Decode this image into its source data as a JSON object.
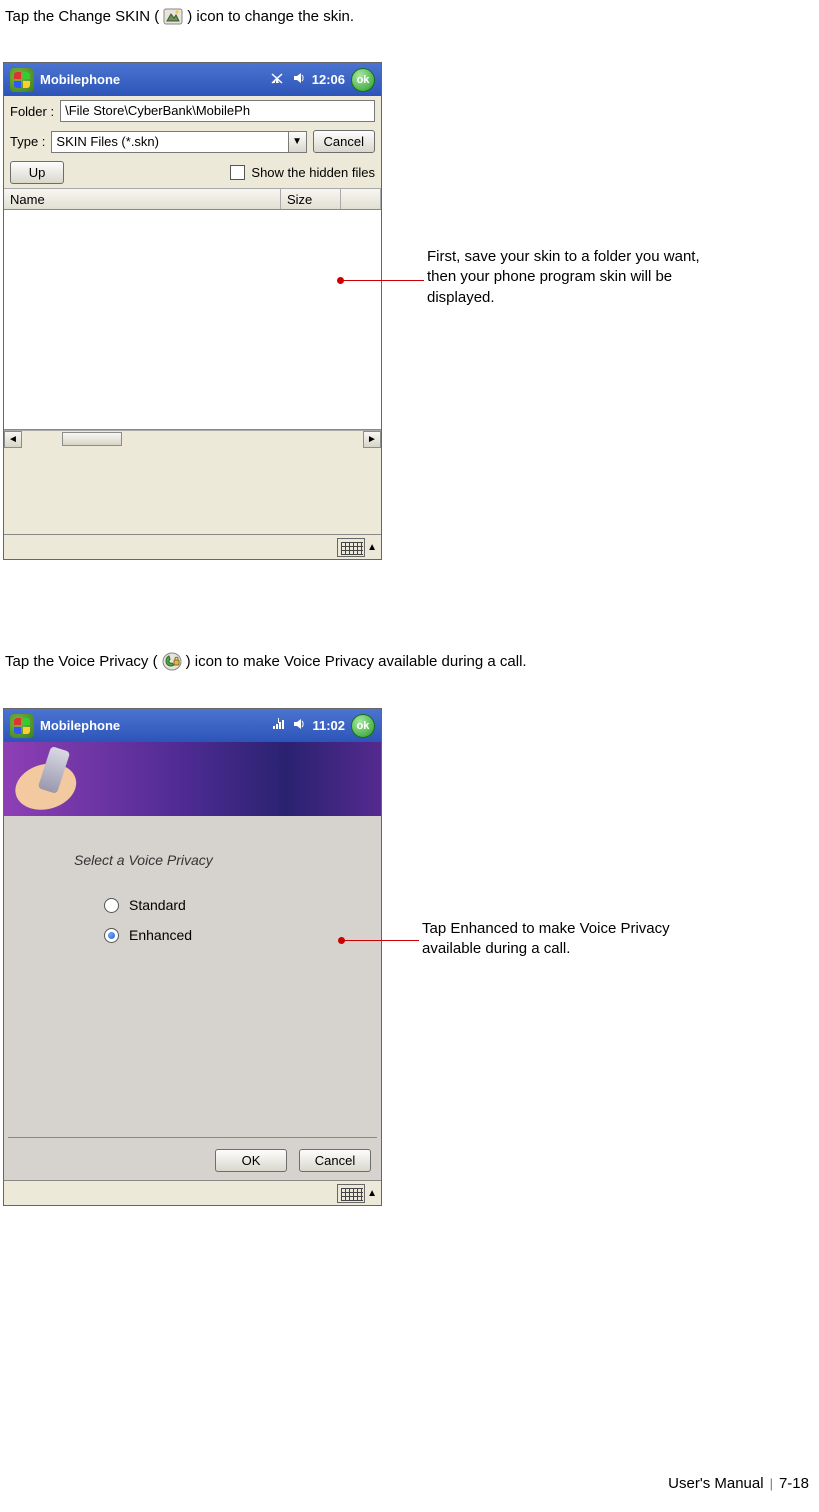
{
  "instructions": {
    "line1_pre": "Tap the Change SKIN (",
    "line1_post": ") icon to change the skin.",
    "line2_pre": "Tap the Voice Privacy (",
    "line2_post": ") icon to make Voice Privacy available during a call."
  },
  "annotations": {
    "skin_note": "First, save your skin to a folder you want, then your phone program skin will be displayed.",
    "privacy_note": "Tap Enhanced to make Voice Privacy available during a call."
  },
  "shot1": {
    "title": "Mobilephone",
    "time": "12:06",
    "ok": "ok",
    "folder_label": "Folder :",
    "folder_value": "\\File Store\\CyberBank\\MobilePh",
    "type_label": "Type :",
    "type_value": "SKIN Files (*.skn)",
    "cancel": "Cancel",
    "up": "Up",
    "show_hidden": "Show the hidden files",
    "col_name": "Name",
    "col_size": "Size"
  },
  "shot2": {
    "title": "Mobilephone",
    "time": "11:02",
    "ok": "ok",
    "prompt": "Select a Voice Privacy",
    "opt_standard": "Standard",
    "opt_enhanced": "Enhanced",
    "btn_ok": "OK",
    "btn_cancel": "Cancel"
  },
  "footer": {
    "manual": "User's Manual",
    "page": "7-18"
  }
}
